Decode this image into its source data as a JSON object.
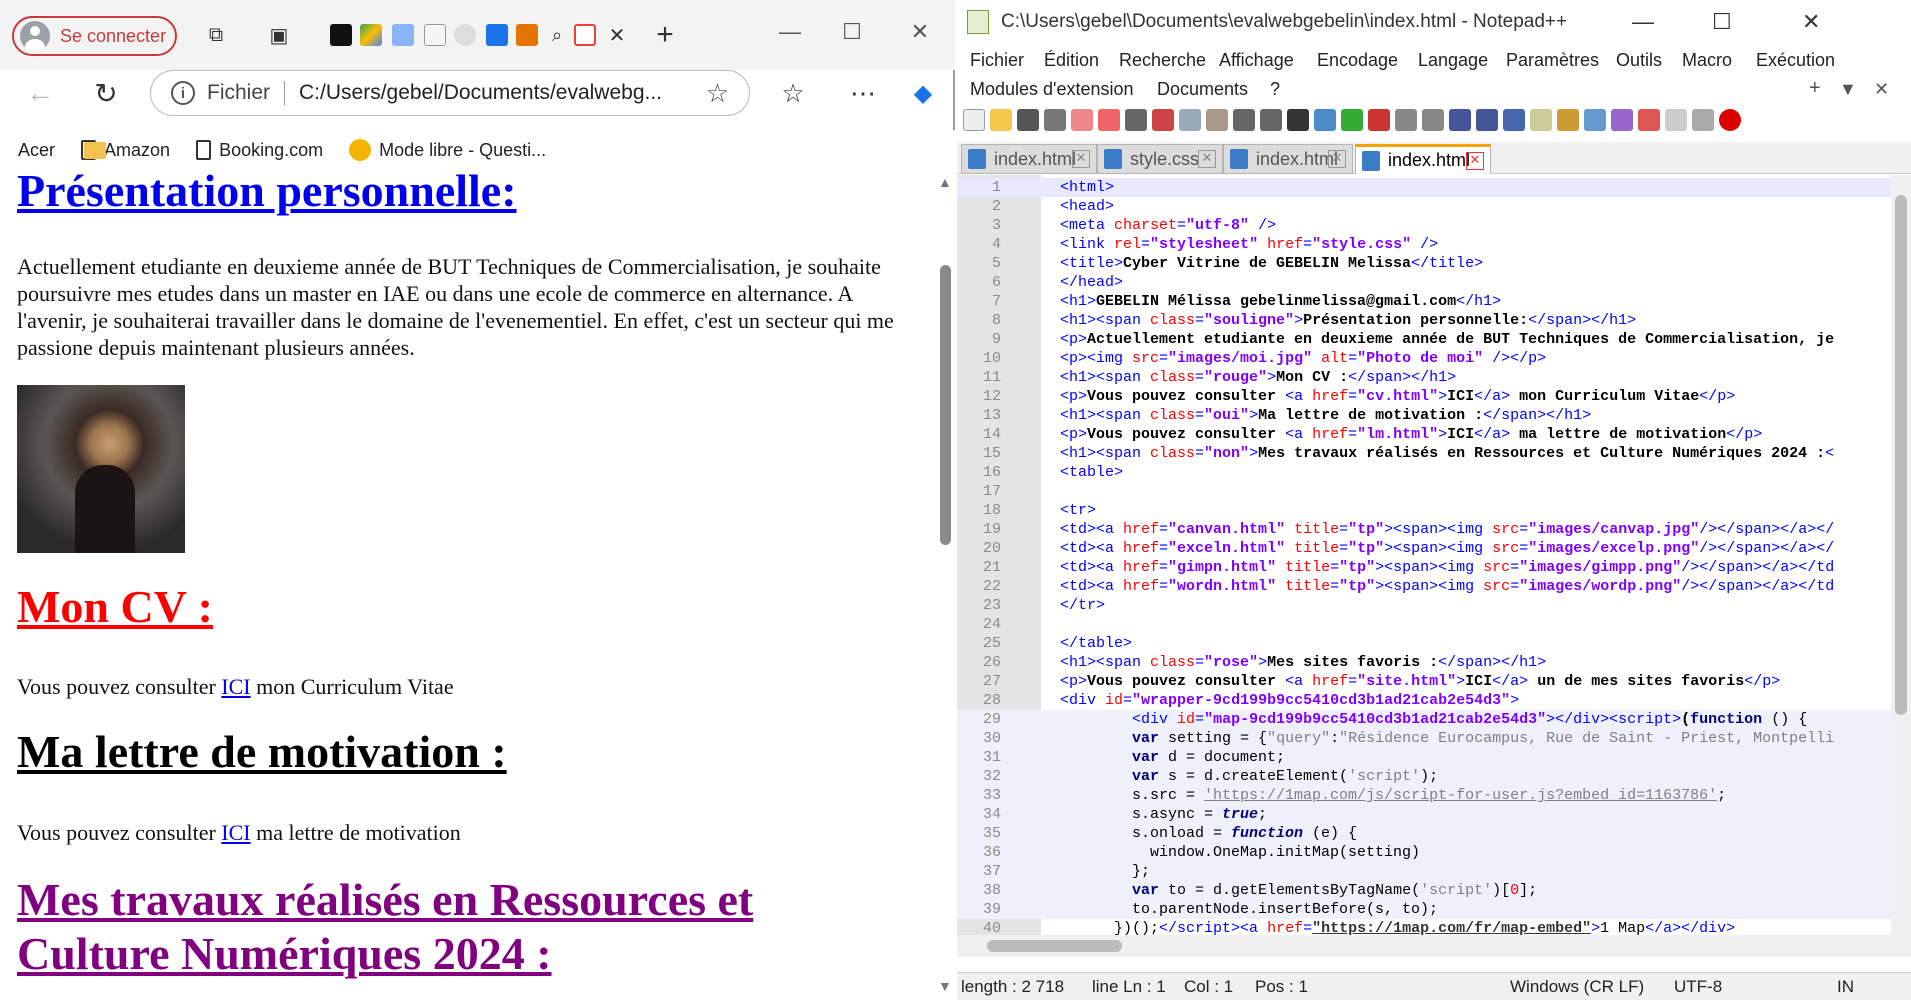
{
  "browser": {
    "signin_label": "Se connecter",
    "address_prefix": "Fichier",
    "address_url": "C:/Users/gebel/Documents/evalwebg...",
    "bookmarks": [
      "Acer",
      "Amazon",
      "Booking.com",
      "Mode libre - Questi..."
    ],
    "page": {
      "h_presentation": "Présentation personnelle:",
      "presentation_text": "Actuellement etudiante en deuxieme année de BUT Techniques de Commercialisation, je souhaite poursuivre mes etudes dans un master en IAE ou dans une ecole de commerce en alternance. A l'avenir, je souhaiterai travailler dans le domaine de l'evenementiel. En effet, c'est un secteur qui me passione depuis maintenant plusieurs années.",
      "h_cv": "Mon CV :",
      "cv_prefix": "Vous pouvez consulter",
      "cv_link": "ICI",
      "cv_suffix": "mon Curriculum Vitae",
      "h_lettre": "Ma lettre de motivation :",
      "lm_prefix": "Vous pouvez consulter",
      "lm_link": "ICI",
      "lm_suffix": "ma lettre de motivation",
      "h_travaux": "Mes travaux réalisés en Ressources et Culture Numériques 2024 :"
    }
  },
  "notepad": {
    "title": "C:\\Users\\gebel\\Documents\\evalwebgebelin\\index.html - Notepad++",
    "menu": [
      "Fichier",
      "Édition",
      "Recherche",
      "Affichage",
      "Encodage",
      "Langage",
      "Paramètres",
      "Outils",
      "Macro",
      "Exécution",
      "Modules d'extension",
      "Documents",
      "?"
    ],
    "tabs": [
      "index.html",
      "style.css",
      "index.html",
      "index.html"
    ],
    "status": {
      "length": "length : 2 718",
      "line": "line Ln : 1",
      "col": "Col : 1",
      "pos": "Pos : 1",
      "eol": "Windows (CR LF)",
      "enc": "UTF-8",
      "mode": "IN"
    }
  },
  "colors": {
    "presentation_heading": "#0000ee",
    "cv_heading": "#ff0000",
    "travaux_heading": "#800080",
    "signin_red": "#c43b3b"
  }
}
